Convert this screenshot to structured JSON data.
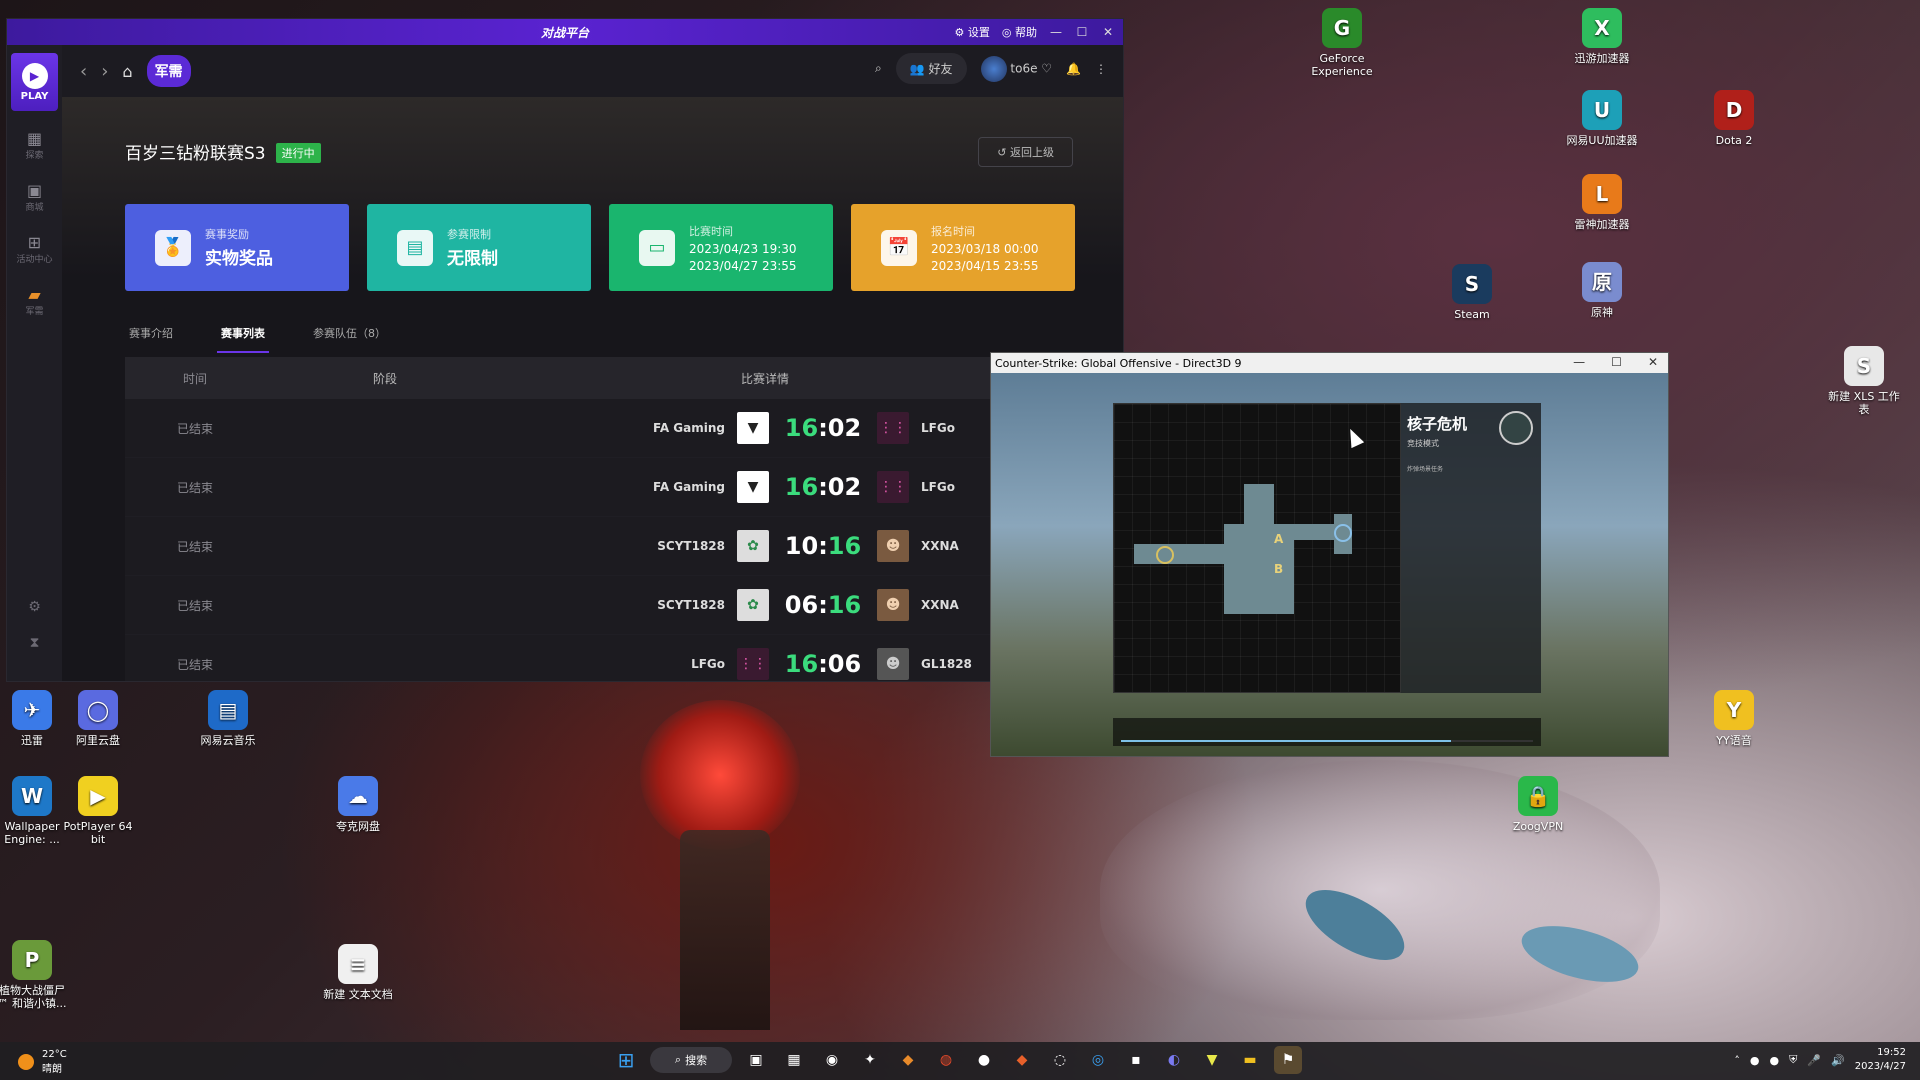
{
  "app": {
    "logo": "对战平台",
    "titlebar": {
      "settings": "设置",
      "help": "帮助"
    },
    "nav": {
      "tag": "军需",
      "friends": "好友",
      "username": "to6e"
    },
    "sidebar": {
      "play": "PLAY",
      "items": [
        "探索",
        "商城",
        "活动中心",
        "军需"
      ]
    },
    "event": {
      "title": "百岁三钻粉联赛S3",
      "status": "进行中",
      "back": "返回上级",
      "cards": [
        {
          "label": "赛事奖励",
          "value": "实物奖品",
          "color": "#4d5fe0"
        },
        {
          "label": "参赛限制",
          "value": "无限制",
          "color": "#1fb5a2"
        },
        {
          "label": "比赛时间",
          "line1": "2023/04/23 19:30",
          "line2": "2023/04/27 23:55",
          "color": "#1ab56e"
        },
        {
          "label": "报名时间",
          "line1": "2023/03/18 00:00",
          "line2": "2023/04/15 23:55",
          "color": "#e6a22b"
        }
      ],
      "tabs": [
        "赛事介绍",
        "赛事列表",
        "参赛队伍（8）"
      ],
      "active_tab": 1
    },
    "table": {
      "headers": [
        "时间",
        "阶段",
        "比赛详情"
      ],
      "rows": [
        {
          "time": "已结束",
          "team_a": "FA Gaming",
          "score_a": "16",
          "score_b": "02",
          "team_b": "LFGo",
          "win": "a"
        },
        {
          "time": "已结束",
          "team_a": "FA Gaming",
          "score_a": "16",
          "score_b": "02",
          "team_b": "LFGo",
          "win": "a"
        },
        {
          "time": "已结束",
          "team_a": "SCYT1828",
          "score_a": "10",
          "score_b": "16",
          "team_b": "XXNA",
          "win": "b"
        },
        {
          "time": "已结束",
          "team_a": "SCYT1828",
          "score_a": "06",
          "score_b": "16",
          "team_b": "XXNA",
          "win": "b"
        },
        {
          "time": "已结束",
          "team_a": "LFGo",
          "score_a": "16",
          "score_b": "06",
          "team_b": "GL1828",
          "win": "a"
        }
      ]
    }
  },
  "csgo": {
    "title": "Counter-Strike: Global Offensive - Direct3D 9",
    "map_name": "核子危机",
    "mode": "竞技模式",
    "desc": "炸弹场景任务",
    "progress": 0.8
  },
  "desktop_icons": [
    {
      "label": "GeForce Experience",
      "glyph": "G",
      "color": "#2a8a2a"
    },
    {
      "label": "迅游加速器",
      "glyph": "X",
      "color": "#2ebd5e"
    },
    {
      "label": "网易UU加速器",
      "glyph": "U",
      "color": "#1da0b8"
    },
    {
      "label": "Dota 2",
      "glyph": "D",
      "color": "#b0201a"
    },
    {
      "label": "雷神加速器",
      "glyph": "L",
      "color": "#e87a1a"
    },
    {
      "label": "Steam",
      "glyph": "S",
      "color": "#1a3b5e"
    },
    {
      "label": "原神",
      "glyph": "原",
      "color": "#7a8ccf"
    },
    {
      "label": "新建 XLS 工作表",
      "glyph": "S",
      "color": "#e8e8e8"
    },
    {
      "label": "迅雷",
      "glyph": "✈",
      "color": "#3a7ae8"
    },
    {
      "label": "阿里云盘",
      "glyph": "◯",
      "color": "#5a6ae0"
    },
    {
      "label": "网易云音乐",
      "glyph": "▤",
      "color": "#1e6ac8"
    },
    {
      "label": "YY语音",
      "glyph": "Y",
      "color": "#f0c020"
    },
    {
      "label": "Wallpaper Engine: ...",
      "glyph": "W",
      "color": "#1e78c8"
    },
    {
      "label": "PotPlayer 64 bit",
      "glyph": "▶",
      "color": "#f0d020"
    },
    {
      "label": "夸克网盘",
      "glyph": "☁",
      "color": "#4a7ae8"
    },
    {
      "label": "ZoogVPN",
      "glyph": "🔒",
      "color": "#2ab84a"
    },
    {
      "label": "植物大战僵尸™ 和谐小镇...",
      "glyph": "P",
      "color": "#6a9a3a"
    },
    {
      "label": "新建 文本文档",
      "glyph": "≡",
      "color": "#f0f0f0"
    }
  ],
  "taskbar": {
    "weather_temp": "22°C",
    "weather_text": "晴朗",
    "search": "搜索",
    "time": "19:52",
    "date": "2023/4/27"
  }
}
